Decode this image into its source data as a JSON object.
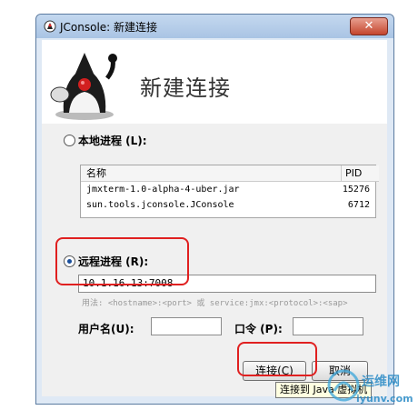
{
  "window": {
    "title": "JConsole: 新建连接",
    "close_glyph": "✕"
  },
  "header": {
    "title": "新建连接"
  },
  "local": {
    "label": "本地进程 (L):",
    "columns": [
      "名称",
      "PID"
    ],
    "rows": [
      {
        "name": "jmxterm-1.0-alpha-4-uber.jar",
        "pid": "15276"
      },
      {
        "name": "sun.tools.jconsole.JConsole",
        "pid": "6712"
      }
    ]
  },
  "remote": {
    "label": "远程进程 (R):",
    "value": "10.1.16.13:7008",
    "usage": "用法: <hostname>:<port> 或 service:jmx:<protocol>:<sap>"
  },
  "auth": {
    "username_label": "用户名(U):",
    "username_value": "",
    "password_label": "口令 (P):",
    "password_value": ""
  },
  "buttons": {
    "connect": "连接(C)",
    "cancel": "取消"
  },
  "tooltip": "连接到 Java 虚拟机",
  "watermark": {
    "text": "运维网",
    "url_text": "iyunv.com"
  }
}
